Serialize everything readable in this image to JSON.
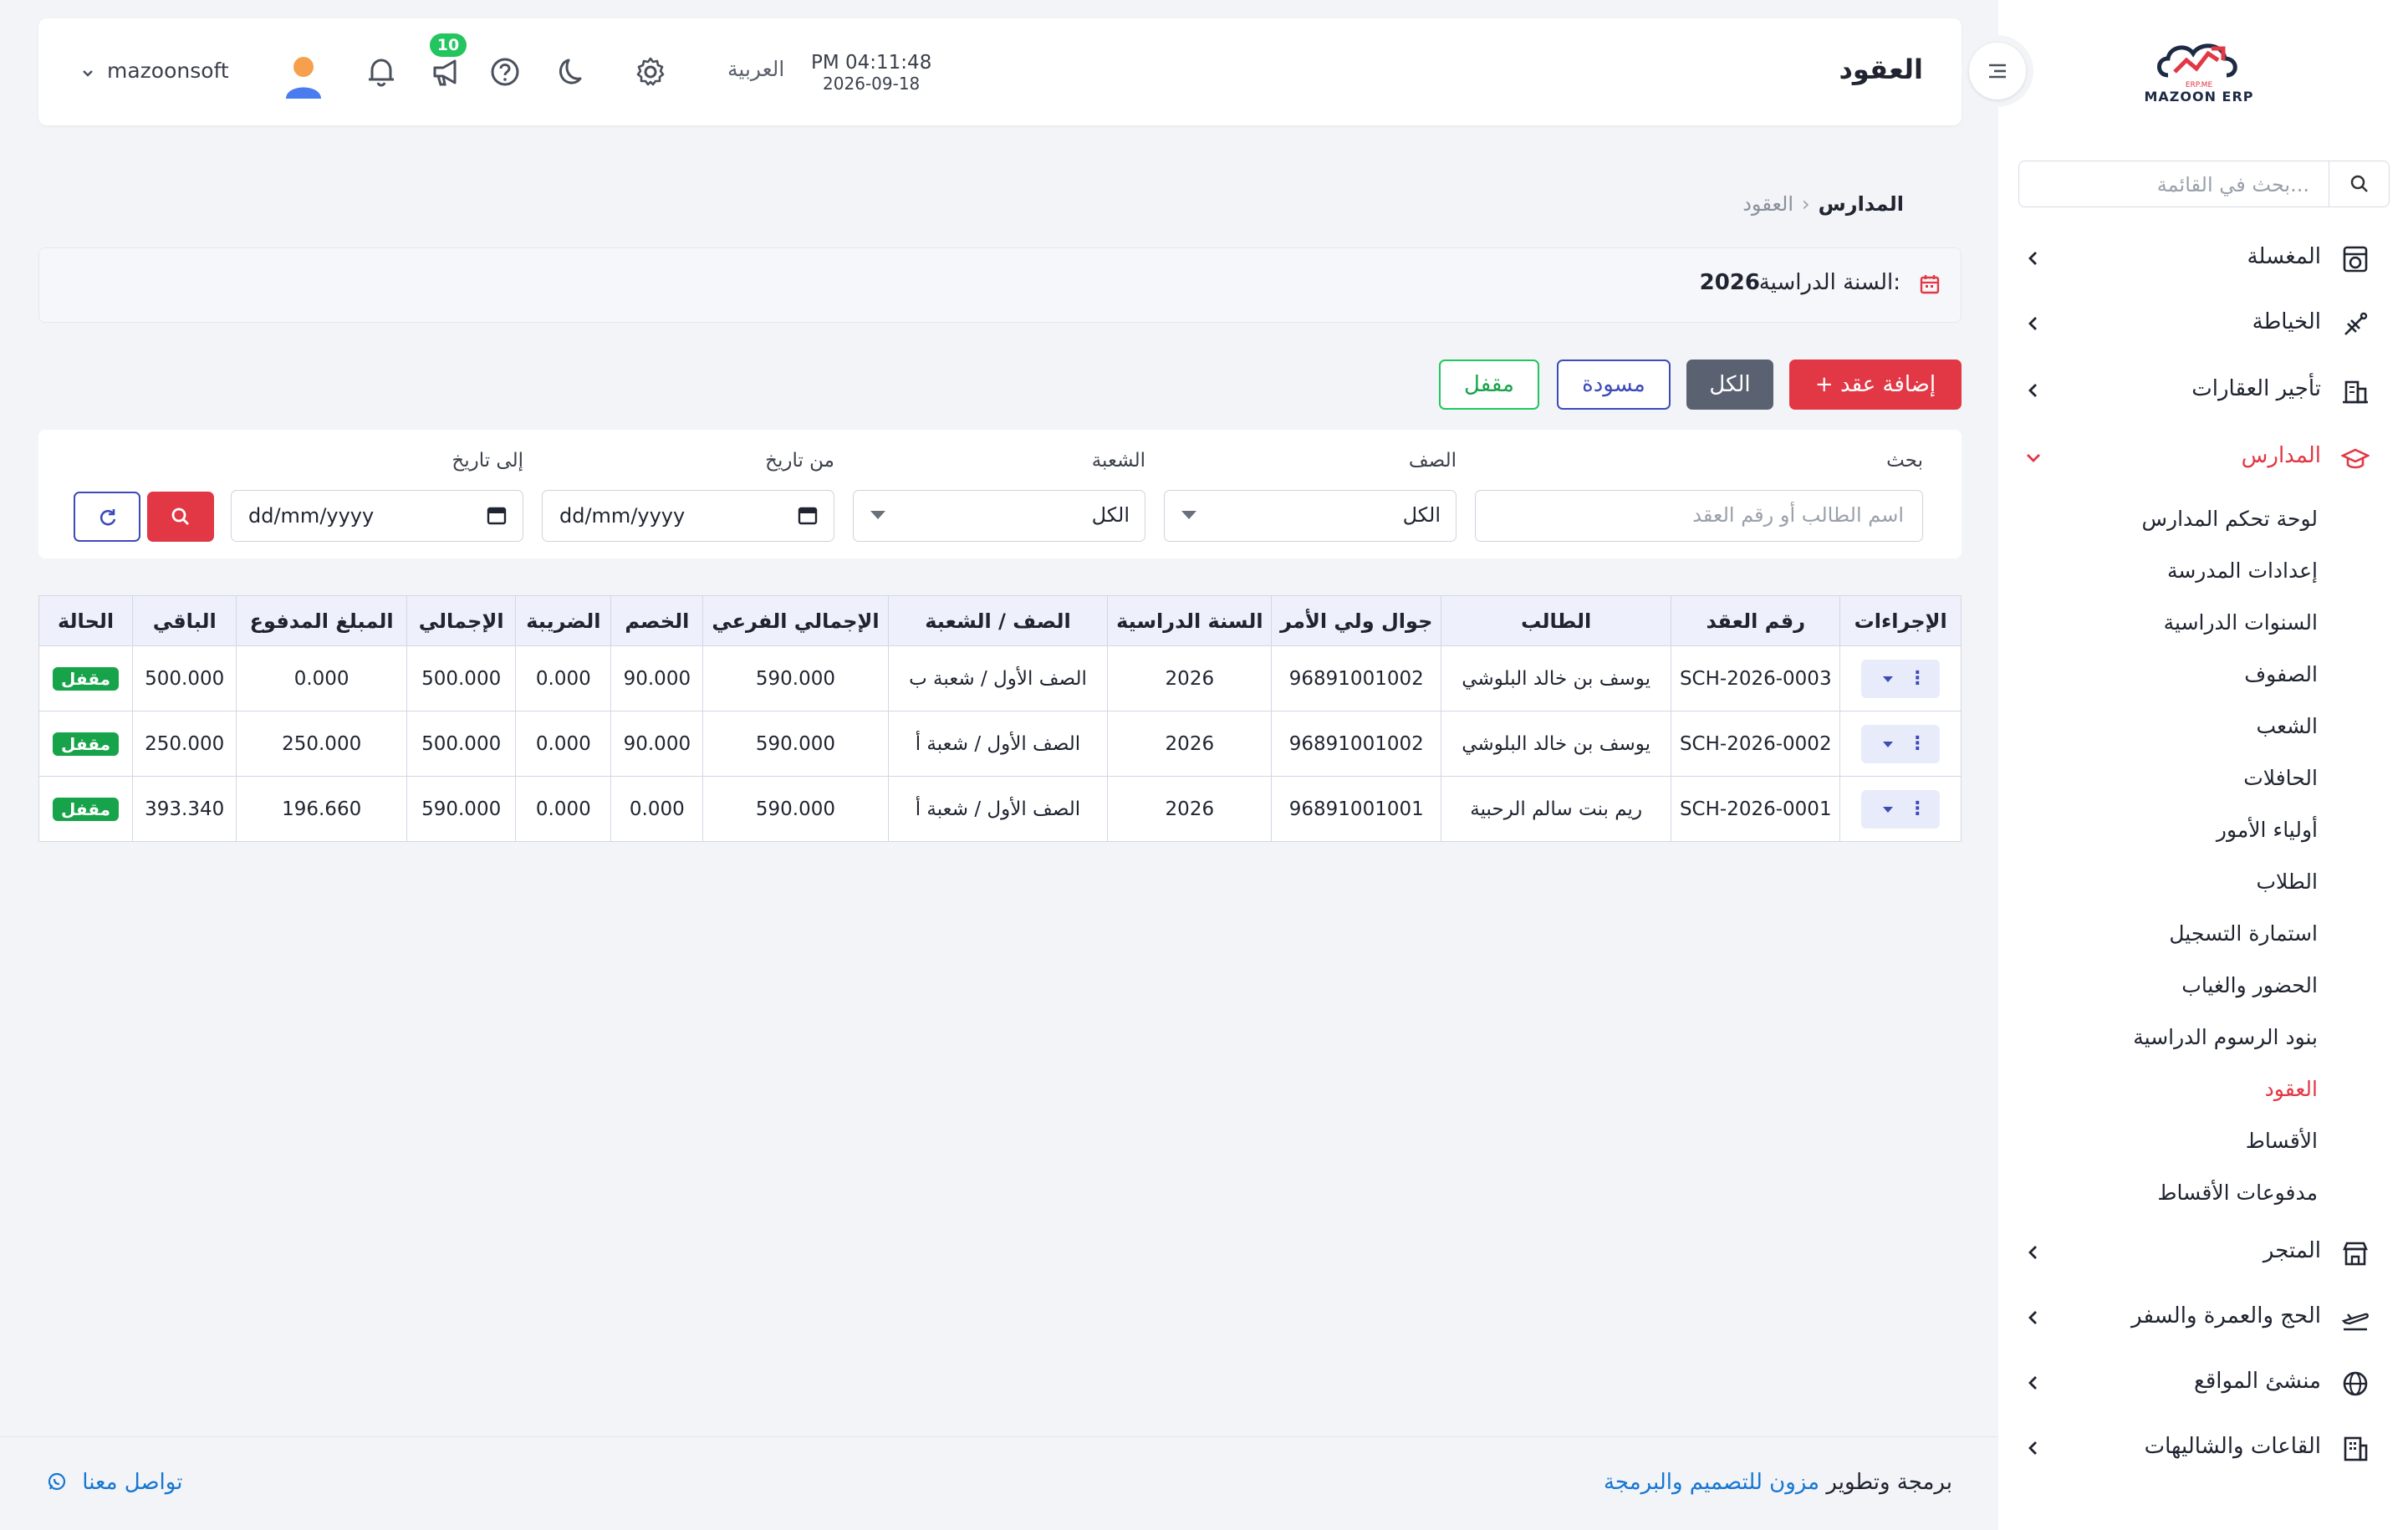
{
  "brand": {
    "name": "MAZOON ERP",
    "tag": "ERP.ME"
  },
  "sidebar": {
    "search_placeholder": "بحث في القائمة...",
    "items": [
      {
        "label": "المغسلة",
        "icon": "laundry-icon"
      },
      {
        "label": "الخياطة",
        "icon": "tailoring-icon"
      },
      {
        "label": "تأجير العقارات",
        "icon": "building-icon"
      },
      {
        "label": "المدارس",
        "icon": "graduation-cap-icon"
      },
      {
        "label": "المتجر",
        "icon": "store-icon"
      },
      {
        "label": "الحج والعمرة والسفر",
        "icon": "plane-icon"
      },
      {
        "label": "منشئ المواقع",
        "icon": "globe-icon"
      },
      {
        "label": "القاعات والشاليهات",
        "icon": "hall-icon"
      }
    ],
    "school_sub": [
      "لوحة تحكم المدارس",
      "إعدادات المدرسة",
      "السنوات الدراسية",
      "الصفوف",
      "الشعب",
      "الحافلات",
      "أولياء الأمور",
      "الطلاب",
      "استمارة التسجيل",
      "الحضور والغياب",
      "بنود الرسوم الدراسية",
      "العقود",
      "الأقساط",
      "مدفوعات الأقساط"
    ]
  },
  "header": {
    "title": "العقود",
    "time": "PM 04:11:48",
    "date": "2026-09-18",
    "language": "العربية",
    "notification_count": "10",
    "username": "mazoonsoft"
  },
  "breadcrumb": {
    "parent": "المدارس",
    "sep": "‹",
    "current": "العقود"
  },
  "year": {
    "label": "السنة الدراسية:",
    "value": "2026"
  },
  "actions": {
    "add": "+  إضافة عقد",
    "all": "الكل",
    "draft": "مسودة",
    "locked": "مقفل"
  },
  "filters": {
    "search_label": "بحث",
    "search_placeholder": "اسم الطالب أو رقم العقد",
    "class_label": "الصف",
    "class_value": "الكل",
    "section_label": "الشعبة",
    "section_value": "الكل",
    "from_label": "من تاريخ",
    "to_label": "إلى تاريخ",
    "date_placeholder": "dd/mm/yyyy"
  },
  "table": {
    "headers": [
      "الإجراءات",
      "رقم العقد",
      "الطالب",
      "جوال ولي الأمر",
      "السنة الدراسية",
      "الصف / الشعبة",
      "الإجمالي الفرعي",
      "الخصم",
      "الضريبة",
      "الإجمالي",
      "المبلغ المدفوع",
      "الباقي",
      "الحالة"
    ],
    "rows": [
      {
        "contract_no": "SCH-2026-0003",
        "student": "يوسف بن خالد البلوشي",
        "phone": "96891001002",
        "year": "2026",
        "class_section": "الصف الأول / شعبة ب",
        "subtotal": "590.000",
        "discount": "90.000",
        "tax": "0.000",
        "total": "500.000",
        "paid": "0.000",
        "remaining": "500.000",
        "status": "مقفل"
      },
      {
        "contract_no": "SCH-2026-0002",
        "student": "يوسف بن خالد البلوشي",
        "phone": "96891001002",
        "year": "2026",
        "class_section": "الصف الأول / شعبة أ",
        "subtotal": "590.000",
        "discount": "90.000",
        "tax": "0.000",
        "total": "500.000",
        "paid": "250.000",
        "remaining": "250.000",
        "status": "مقفل"
      },
      {
        "contract_no": "SCH-2026-0001",
        "student": "ريم بنت سالم الرحبية",
        "phone": "96891001001",
        "year": "2026",
        "class_section": "الصف الأول / شعبة أ",
        "subtotal": "590.000",
        "discount": "0.000",
        "tax": "0.000",
        "total": "590.000",
        "paid": "196.660",
        "remaining": "393.340",
        "status": "مقفل"
      }
    ]
  },
  "footer": {
    "credit_prefix": "برمجة وتطوير",
    "credit_link": "مزون للتصميم والبرمجة",
    "contact": "تواصل معنا"
  },
  "colors": {
    "accent": "#e23744",
    "primary": "#3c4bb8",
    "success": "#16a34a",
    "link": "#1677d2"
  }
}
